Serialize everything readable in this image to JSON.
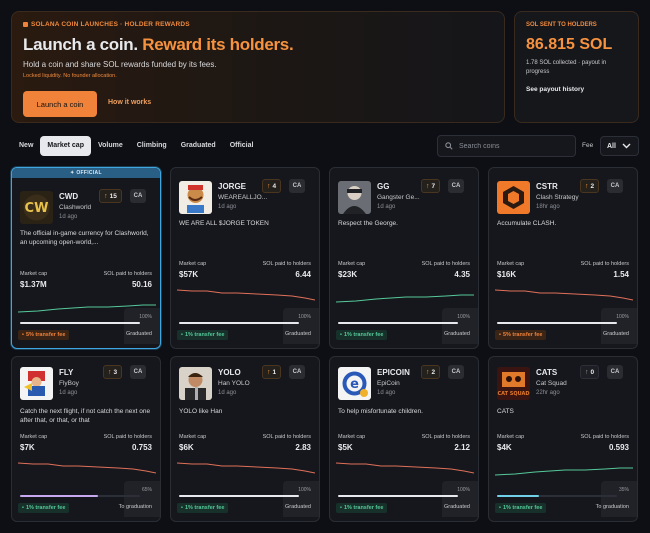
{
  "hero": {
    "kicker": "SOLANA COIN LAUNCHES · HOLDER REWARDS",
    "title_main": "Launch a coin.",
    "title_accent": "Reward its holders.",
    "subtitle": "Hold a coin and share SOL rewards funded by its fees.",
    "fineprint": "Locked liquidity. No founder allocation.",
    "launch_label": "Launch a coin",
    "how_label": "How it works"
  },
  "sent": {
    "kicker": "SOL SENT TO HOLDERS",
    "amount": "86.815 SOL",
    "detail": "1.78 SOL collected · payout in progress",
    "link": "See payout history"
  },
  "tabs": [
    "New",
    "Market cap",
    "Volume",
    "Climbing",
    "Graduated",
    "Official"
  ],
  "active_tab": 1,
  "search": {
    "placeholder": "Search coins"
  },
  "fee_filter": {
    "label": "Fee",
    "value": "All"
  },
  "labels": {
    "market_cap": "Market cap",
    "sol_paid": "SOL paid to holders",
    "ca": "CA",
    "official": "✦ OFFICIAL"
  },
  "colors": {
    "accent": "#f0823a",
    "up": "#55c99a",
    "down": "#e0705a",
    "official": "#3fa6e0"
  },
  "cards": [
    {
      "symbol": "CWD",
      "name": "Clashworld",
      "age": "1d ago",
      "rank": "15",
      "official": true,
      "desc": "The official in-game currency for Clashworld, an upcoming open-world,...",
      "mcap": "$1.37M",
      "sol": "50.16",
      "progress_pct": "100%",
      "progress": 1.0,
      "fee": "5% transfer fee",
      "fee_tone": "orange",
      "status": "Graduated",
      "trend": "up"
    },
    {
      "symbol": "JORGE",
      "name": "WEAREALLJO...",
      "age": "1d ago",
      "rank": "4",
      "official": false,
      "desc": "WE ARE ALL $JORGE TOKEN",
      "mcap": "$57K",
      "sol": "6.44",
      "progress_pct": "100%",
      "progress": 1.0,
      "fee": "1% transfer fee",
      "fee_tone": "green",
      "status": "Graduated",
      "trend": "down"
    },
    {
      "symbol": "GG",
      "name": "Gangster Ge...",
      "age": "1d ago",
      "rank": "7",
      "official": false,
      "desc": "Respect the George.",
      "mcap": "$23K",
      "sol": "4.35",
      "progress_pct": "100%",
      "progress": 1.0,
      "fee": "1% transfer fee",
      "fee_tone": "green",
      "status": "Graduated",
      "trend": "up"
    },
    {
      "symbol": "CSTR",
      "name": "Clash Strategy",
      "age": "18hr ago",
      "rank": "2",
      "official": false,
      "desc": "Accumulate CLASH.",
      "mcap": "$16K",
      "sol": "1.54",
      "progress_pct": "100%",
      "progress": 1.0,
      "fee": "5% transfer fee",
      "fee_tone": "orange",
      "status": "Graduated",
      "trend": "down"
    },
    {
      "symbol": "FLY",
      "name": "FlyBoy",
      "age": "1d ago",
      "rank": "3",
      "official": false,
      "desc": "Catch the next flight, if not catch the next one after that, or that, or that",
      "mcap": "$7K",
      "sol": "0.753",
      "progress_pct": "65%",
      "progress": 0.65,
      "fee": "1% transfer fee",
      "fee_tone": "green",
      "status": "To graduation",
      "trend": "down"
    },
    {
      "symbol": "YOLO",
      "name": "Han YOLO",
      "age": "1d ago",
      "rank": "1",
      "official": false,
      "desc": "YOLO like Han",
      "mcap": "$6K",
      "sol": "2.83",
      "progress_pct": "100%",
      "progress": 1.0,
      "fee": "1% transfer fee",
      "fee_tone": "green",
      "status": "Graduated",
      "trend": "down"
    },
    {
      "symbol": "EPICOIN",
      "name": "EpiCoin",
      "age": "1d ago",
      "rank": "2",
      "official": false,
      "desc": "To help misfortunate children.",
      "mcap": "$5K",
      "sol": "2.12",
      "progress_pct": "100%",
      "progress": 1.0,
      "fee": "1% transfer fee",
      "fee_tone": "green",
      "status": "Graduated",
      "trend": "down"
    },
    {
      "symbol": "CATS",
      "name": "Cat Squad",
      "age": "22hr ago",
      "rank": "0",
      "official": false,
      "desc": "CATS",
      "mcap": "$4K",
      "sol": "0.593",
      "progress_pct": "35%",
      "progress": 0.35,
      "fee": "1% transfer fee",
      "fee_tone": "green",
      "status": "To graduation",
      "trend": "up"
    }
  ]
}
